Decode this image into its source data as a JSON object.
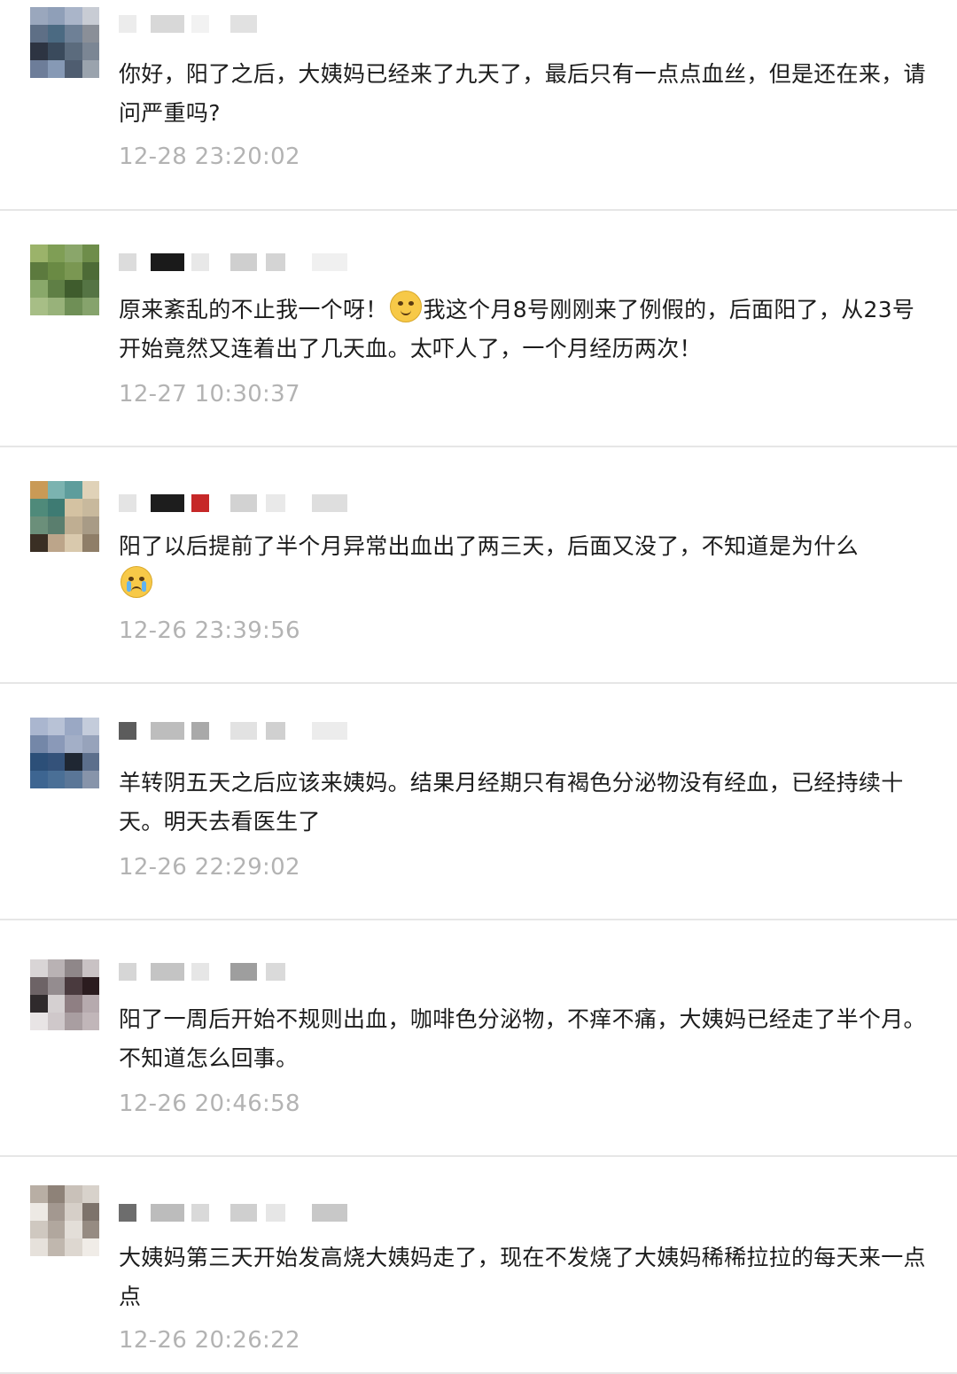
{
  "comments": [
    {
      "text": "你好，阳了之后，大姨妈已经来了九天了，最后只有一点点血丝，但是还在来，请问严重吗?",
      "time": "12-28 23:20:02",
      "avatar_colors": [
        "#9aa7bd",
        "#8f9fb8",
        "#aab5c9",
        "#c8ccd4",
        "#5e6f86",
        "#4b6a82",
        "#6e8096",
        "#8a8f98",
        "#2d3442",
        "#3a4a5c",
        "#5b6b7d",
        "#7b8694",
        "#6d7d99",
        "#8699b5",
        "#4f5d70",
        "#9aa3ad"
      ],
      "name_colors": [
        "#ececec",
        "#d8d8d8",
        "#f2f2f2",
        "#e1e1e1"
      ]
    },
    {
      "text_before_emoji": "原来紊乱的不止我一个呀！",
      "emoji": "rolling-eyes-emoji",
      "text_after_emoji": "我这个月8号刚刚来了例假的，后面阳了，从23号开始竟然又连着出了几天血。太吓人了，一个月经历两次！",
      "time": "12-27 10:30:37",
      "avatar_colors": [
        "#9bb36a",
        "#7f9e55",
        "#8aa66a",
        "#6e8d4a",
        "#5c7a3e",
        "#6a8a44",
        "#7a9752",
        "#4d6b36",
        "#89a86a",
        "#5f7f45",
        "#3f5c2d",
        "#557444",
        "#a7be86",
        "#98b27a",
        "#6f8f56",
        "#86a36c"
      ],
      "name_colors": [
        "#dcdcdc",
        "#1a1a1a",
        "#e8e8e8",
        "#cfcfcf",
        "#d4d4d4",
        "#f0f0f0"
      ]
    },
    {
      "text": "阳了以后提前了半个月异常出血出了两三天，后面又没了，不知道是为什么",
      "emoji_end": "crying-emoji",
      "time": "12-26 23:39:56",
      "avatar_colors": [
        "#c99a56",
        "#7bb3b0",
        "#5e9d9c",
        "#e0d2b8",
        "#4f8a7a",
        "#3e7b73",
        "#d4c2a2",
        "#c8b99d",
        "#6b8f7a",
        "#5a7e6e",
        "#bfae92",
        "#a89b86",
        "#3a2f24",
        "#bca58a",
        "#d9c9ad",
        "#8f7e68"
      ],
      "name_colors": [
        "#e4e4e4",
        "#1d1d1d",
        "#c62828",
        "#d2d2d2",
        "#e9e9e9",
        "#dedede"
      ]
    },
    {
      "text": "羊转阴五天之后应该来姨妈。结果月经期只有褐色分泌物没有经血，已经持续十天。明天去看医生了",
      "time": "12-26 22:29:02",
      "avatar_colors": [
        "#aab6cf",
        "#b8c2d6",
        "#9aa8c4",
        "#c4ccdb",
        "#7487a8",
        "#8a99b8",
        "#a3afc7",
        "#97a3bb",
        "#2c4f78",
        "#34527a",
        "#1f2733",
        "#5c6f8c",
        "#3d6591",
        "#4a6f96",
        "#5a7697",
        "#8794aa"
      ],
      "name_colors": [
        "#5c5c5c",
        "#bdbdbd",
        "#a9a9a9",
        "#e2e2e2",
        "#d0d0d0",
        "#ececec"
      ]
    },
    {
      "text": "阳了一周后开始不规则出血，咖啡色分泌物，不痒不痛，大姨妈已经走了半个月。不知道怎么回事。",
      "time": "12-26 20:46:58",
      "avatar_colors": [
        "#d9d5d6",
        "#b9b2b4",
        "#8f8789",
        "#c9c2c4",
        "#6d6366",
        "#948c8f",
        "#4a3a3e",
        "#2b1c1f",
        "#2f2a2c",
        "#d5d0d1",
        "#8f7f83",
        "#b6aaae",
        "#e8e4e5",
        "#cfc8ca",
        "#a99ea1",
        "#c1b6b9"
      ],
      "name_colors": [
        "#d6d6d6",
        "#c4c4c4",
        "#e6e6e6",
        "#9e9e9e",
        "#dadada"
      ]
    },
    {
      "text": "大姨妈第三天开始发高烧大姨妈走了，现在不发烧了大姨妈稀稀拉拉的每天来一点点",
      "time": "12-26 20:26:22",
      "avatar_colors": [
        "#b8aea4",
        "#8e8278",
        "#c9c1b9",
        "#d8d2cb",
        "#ede9e4",
        "#a39890",
        "#d6cfc8",
        "#7d736b",
        "#cfc8c0",
        "#b1a79e",
        "#e3ded8",
        "#968b82",
        "#e6e1db",
        "#c0b7ae",
        "#ddd7d0",
        "#f0ece7"
      ],
      "name_colors": [
        "#6d6d6d",
        "#bcbcbc",
        "#d9d9d9",
        "#cfcfcf",
        "#e6e6e6",
        "#c8c8c8"
      ]
    }
  ]
}
